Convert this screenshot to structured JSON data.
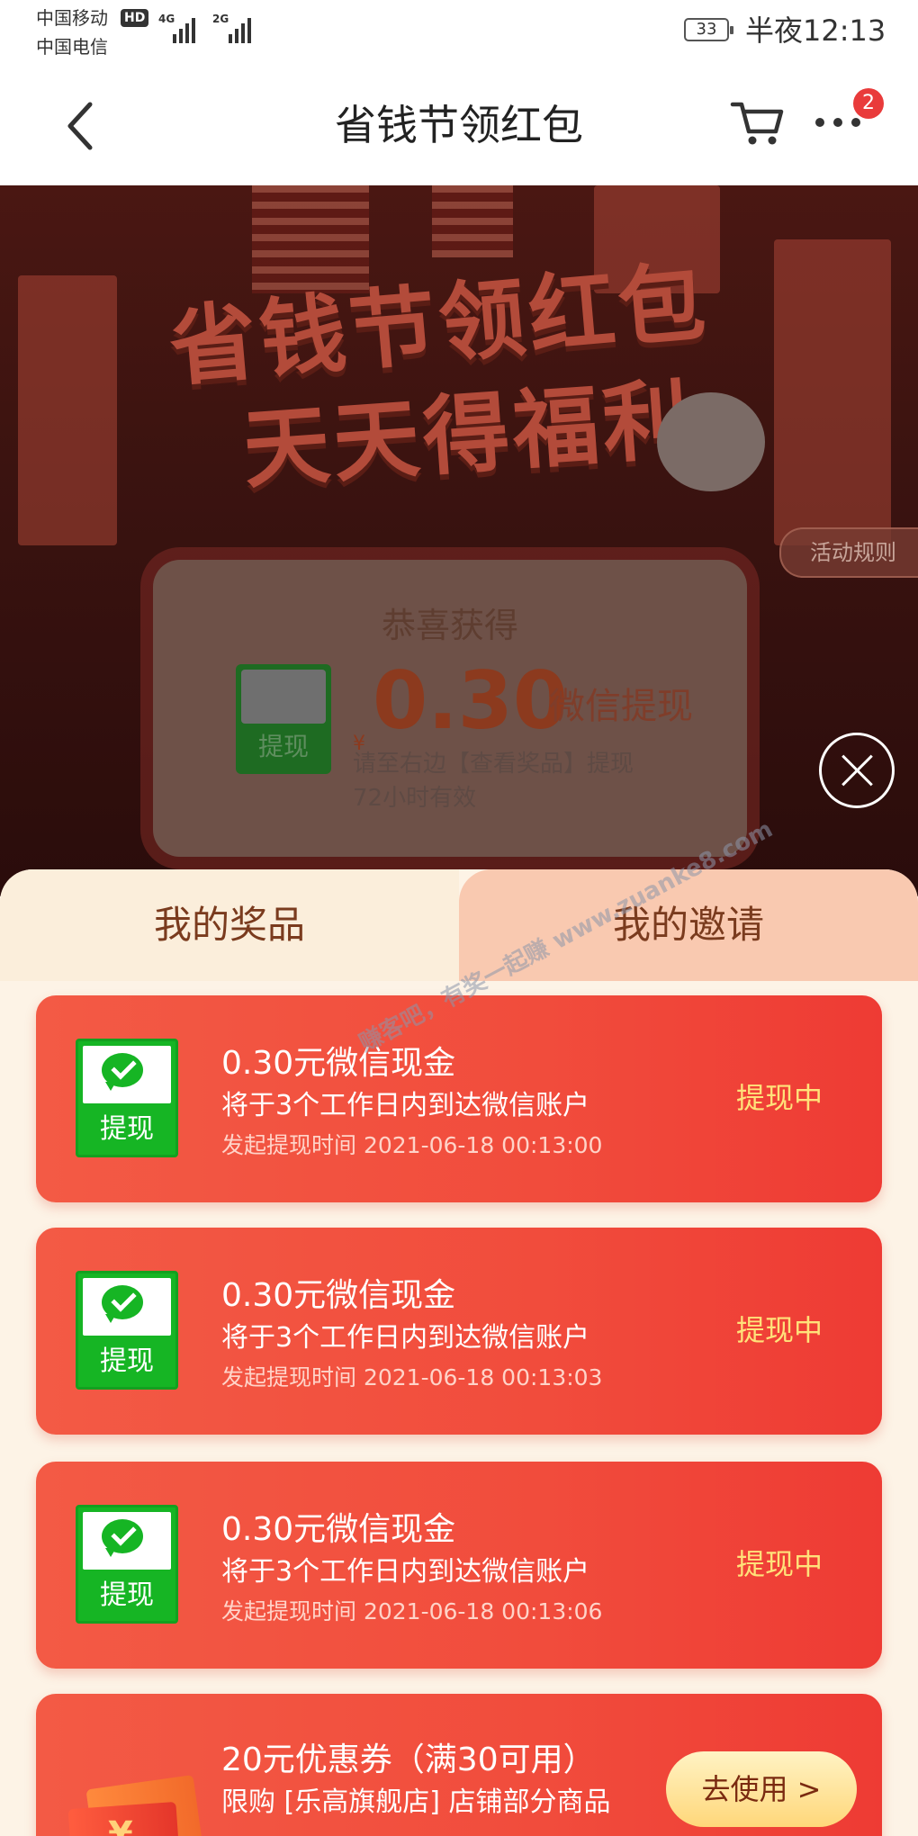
{
  "status_bar": {
    "carrier_1": "中国移动",
    "hd_badge": "HD",
    "network_1": "4G",
    "carrier_2": "中国电信",
    "network_2": "2G",
    "battery": "33",
    "time": "半夜12:13"
  },
  "nav": {
    "title": "省钱节领红包",
    "more_badge": "2",
    "icons": [
      "back-arrow-icon",
      "cart-icon",
      "more-icon"
    ]
  },
  "banner": {
    "title_line_1": "省钱节领红包",
    "title_line_2": "天天得福利",
    "rules_button": "活动规则",
    "congrats": "恭喜获得",
    "wechat_badge": "提现",
    "currency": "¥",
    "amount": "0.30",
    "amount_type": "微信提现",
    "hint": "请至右边【查看奖品】提现",
    "validity": "72小时有效"
  },
  "tabs": {
    "my_prizes": "我的奖品",
    "my_invites": "我的邀请"
  },
  "watermark": "赚客吧，有奖一起赚 www.zuanke8.com",
  "prizes": [
    {
      "badge": "提现",
      "title": "0.30元微信现金",
      "desc": "将于3个工作日内到达微信账户",
      "time": "发起提现时间 2021-06-18 00:13:00",
      "status": "提现中"
    },
    {
      "badge": "提现",
      "title": "0.30元微信现金",
      "desc": "将于3个工作日内到达微信账户",
      "time": "发起提现时间 2021-06-18 00:13:03",
      "status": "提现中"
    },
    {
      "badge": "提现",
      "title": "0.30元微信现金",
      "desc": "将于3个工作日内到达微信账户",
      "time": "发起提现时间 2021-06-18 00:13:06",
      "status": "提现中"
    }
  ],
  "coupon": {
    "currency": "¥",
    "title": "20元优惠券（满30可用）",
    "desc": "限购 [乐高旗舰店] 店铺部分商品",
    "button": "去使用 >"
  },
  "colors": {
    "accent_red": "#f14c3c",
    "status_yellow": "#ffe27a",
    "wechat_green": "#16b524",
    "sheet_bg": "#fdf3e6"
  }
}
